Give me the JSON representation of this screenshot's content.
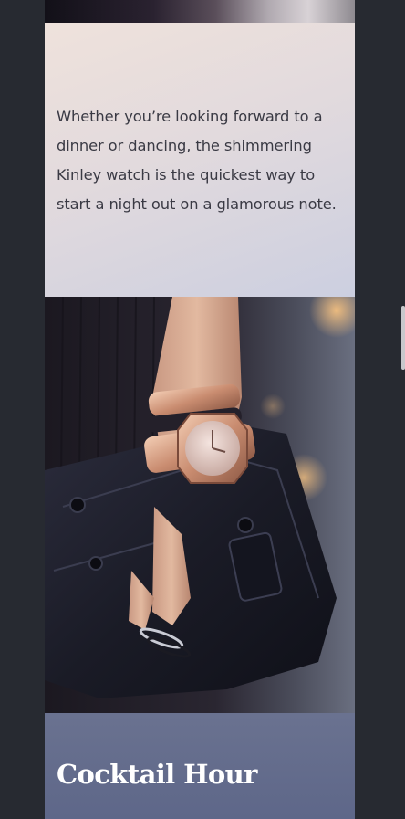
{
  "intro": {
    "text": "Whether you’re looking forward to a dinner or dancing, the shimmering Kinley watch is the quickest way to start a night out on a glamorous note."
  },
  "section": {
    "heading": "Cocktail Hour"
  },
  "colors": {
    "page_background": "#272a31",
    "intro_panel_start": "#efe2dc",
    "intro_panel_end": "#cccfe0",
    "section_panel": "#636c8c",
    "heading_text": "#ffffff",
    "body_text": "#3a3a44"
  }
}
